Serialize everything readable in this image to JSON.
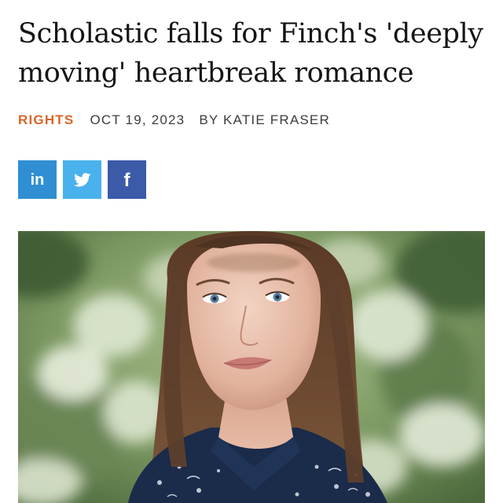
{
  "article": {
    "headline": "Scholastic falls for Finch's 'deeply moving' heartbreak romance",
    "category": "RIGHTS",
    "date": "OCT 19, 2023",
    "byline": "BY KATIE FRASER"
  },
  "share": {
    "linkedin_label": "in",
    "twitter_icon": "twitter-bird-icon",
    "facebook_label": "f"
  },
  "colors": {
    "category_accent": "#d8662a",
    "linkedin": "#2f8fd2",
    "twitter": "#49b1ec",
    "facebook": "#3b5aa8",
    "headline": "#151515"
  },
  "hero": {
    "subject": "portrait-photo"
  }
}
